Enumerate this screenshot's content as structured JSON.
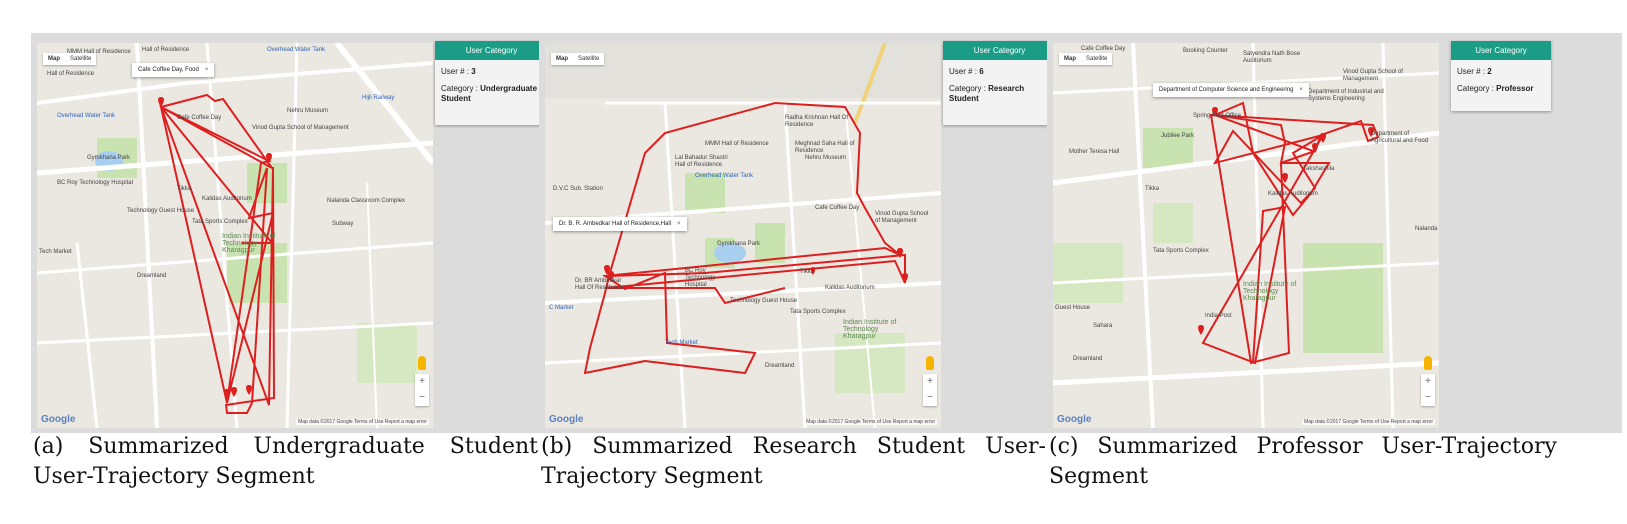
{
  "map_controls": {
    "map": "Map",
    "satellite": "Satellite",
    "zoom_in": "+",
    "zoom_out": "−",
    "google": "Google",
    "attribution": "Map data ©2017 Google   Terms of Use   Report a map error"
  },
  "colors": {
    "route": "#dd1f1f",
    "card_header": "#1a9c86",
    "park": "#c8e3b0",
    "water": "#a9cff0"
  },
  "panels": [
    {
      "tooltip": "Cafe Coffee Day, Food",
      "card": {
        "header": "User Category",
        "user_label": "User # :",
        "user_value": "3",
        "category_label": "Category :",
        "category_value": "Undergraduate Student"
      },
      "pois": [
        "MMM Hall of Residence",
        "Hall of Residence",
        "Hall of Residence",
        "Overhead Water Tank",
        "Overhead Water Tank",
        "Cafe Coffee Day",
        "Nehru Museum",
        "Vinod Gupta School of Management",
        "Gymkhana Park",
        "BC Roy Technology Hospital",
        "Technology Guest House",
        "Kalidas Auditorium",
        "Tata Sports Complex",
        "Indian Institute of Technology Kharagpur",
        "Nalanda Classroom Complex",
        "Subway",
        "Dreamland",
        "Hijli Railway",
        "Tikka",
        "Tech Market"
      ],
      "caption": "(a) Summarized Undergraduate Student User-Trajectory Segment"
    },
    {
      "tooltip": "Dr. B. R. Ambedkar Hall of Residence,Hall",
      "card": {
        "header": "User Category",
        "user_label": "User # :",
        "user_value": "6",
        "category_label": "Category :",
        "category_value": "Research Student"
      },
      "pois": [
        "Radha Krishnan Hall Of Residence",
        "MMM Hall of Residence",
        "Meghnad Saha Hall of Residence",
        "Lal Bahadur Shastri Hall of Residence",
        "Overhead Water Tank",
        "Nehru Museum",
        "Cafe Coffee Day",
        "Vinod Gupta School of Management",
        "Gymkhana Park",
        "D.V.C Sub. Station",
        "Dr. BR Ambedkar Hall Of Residence",
        "BC Roy Technology Hospital",
        "Technology Guest House",
        "Kalidas Auditorium",
        "Tata Sports Complex",
        "Indian Institute of Technology Kharagpur",
        "Tech Market",
        "Dreamland",
        "C Market",
        "Tikka"
      ],
      "caption": "(b) Summarized Research Student User-Trajectory Segment"
    },
    {
      "tooltip": "Department of Computer Science and Engineering",
      "card": {
        "header": "User Category",
        "user_label": "User # :",
        "user_value": "2",
        "category_label": "Category :",
        "category_value": "Professor"
      },
      "pois": [
        "Cafe Coffee Day",
        "Booking Counter",
        "Satyendra Nath Bose Auditorium",
        "Vinod Gupta School of Management",
        "Department of Industrial and Systems Engineering",
        "Spring Fest Office",
        "Jubilee Park",
        "Mother Teresa Hall",
        "Department of Agricultural and Food",
        "Takshashila",
        "Kalidas Auditorium",
        "Tata Sports Complex",
        "Indian Institute of Technology Kharagpur",
        "India Post",
        "Guest House",
        "Sahara",
        "Dreamland",
        "Tikka",
        "Nalanda"
      ],
      "caption": "(c) Summarized Professor User-Trajectory Segment"
    }
  ]
}
